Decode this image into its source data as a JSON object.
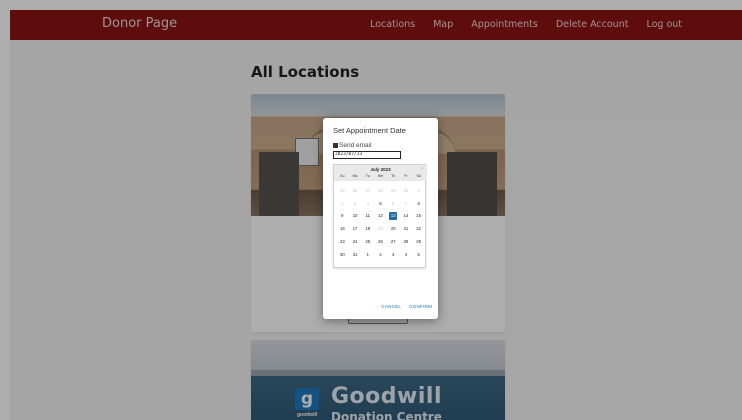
{
  "navbar": {
    "brand": "Donor Page",
    "links": [
      "Locations",
      "Map",
      "Appointments",
      "Delete Account",
      "Log out"
    ]
  },
  "main": {
    "title": "All Locations",
    "cards": [
      {
        "image_text": ""
      },
      {
        "logo_letter": "g",
        "logo_small": "goodwill",
        "name": "Goodwill",
        "subtitle": "Donation Centre"
      }
    ]
  },
  "dialog": {
    "title": "Set Appointment Date",
    "send_email_label": "Send email",
    "send_email_checked": true,
    "date_value": "2023/07/13",
    "calendar": {
      "month_label": "July 2023",
      "next_icon": "chevron-right-icon",
      "weekdays": [
        "Su",
        "Mo",
        "Tu",
        "We",
        "Th",
        "Fr",
        "Sa"
      ],
      "weeks": [
        [
          "25",
          "26",
          "27",
          "28",
          "29",
          "30",
          "1"
        ],
        [
          "2",
          "3",
          "4",
          "5",
          "6",
          "7",
          "8"
        ],
        [
          "9",
          "10",
          "11",
          "12",
          "13",
          "14",
          "15"
        ],
        [
          "16",
          "17",
          "18",
          "19",
          "20",
          "21",
          "22"
        ],
        [
          "23",
          "24",
          "25",
          "26",
          "27",
          "28",
          "29"
        ],
        [
          "30",
          "31",
          "1",
          "2",
          "3",
          "4",
          "5"
        ]
      ],
      "disabled": [
        [
          true,
          true,
          true,
          true,
          true,
          true,
          true
        ],
        [
          true,
          true,
          true,
          false,
          true,
          true,
          false
        ],
        [
          false,
          false,
          false,
          false,
          false,
          false,
          false
        ],
        [
          false,
          false,
          false,
          true,
          false,
          false,
          false
        ],
        [
          false,
          false,
          false,
          false,
          false,
          false,
          false
        ],
        [
          false,
          false,
          false,
          false,
          false,
          false,
          false
        ]
      ],
      "selected": "13",
      "selected_color": "#216ba5"
    },
    "cancel_label": "CANCEL",
    "confirm_label": "CONFIRM"
  },
  "colors": {
    "navbar": "#8b1212",
    "accent": "#216ba5"
  }
}
